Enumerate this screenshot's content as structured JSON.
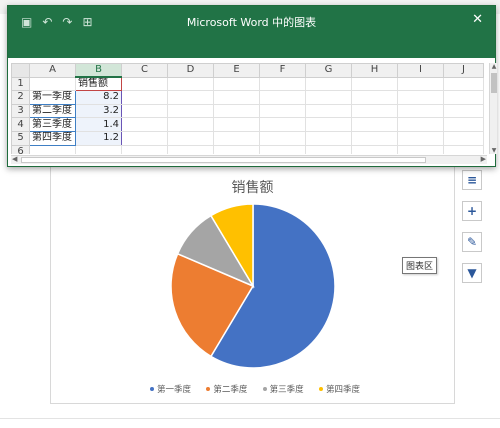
{
  "excel": {
    "title": "Microsoft Word 中的图表",
    "close": "✕",
    "qat": {
      "save": "▣",
      "undo": "↶",
      "redo": "↷",
      "table": "⊞"
    },
    "columns": [
      "A",
      "B",
      "C",
      "D",
      "E",
      "F",
      "G",
      "H",
      "I",
      "J"
    ],
    "rows": [
      {
        "n": "1",
        "a": "",
        "b": "销售额"
      },
      {
        "n": "2",
        "a": "第一季度",
        "b": "8.2"
      },
      {
        "n": "3",
        "a": "第二季度",
        "b": "3.2"
      },
      {
        "n": "4",
        "a": "第三季度",
        "b": "1.4"
      },
      {
        "n": "5",
        "a": "第四季度",
        "b": "1.2"
      },
      {
        "n": "6",
        "a": "",
        "b": ""
      }
    ]
  },
  "side_tools": {
    "layout": "≡",
    "add": "+",
    "style": "✎",
    "filter": "▼"
  },
  "tooltip": "图表区",
  "chart_data": {
    "type": "pie",
    "title": "销售额",
    "categories": [
      "第一季度",
      "第二季度",
      "第三季度",
      "第四季度"
    ],
    "values": [
      8.2,
      3.2,
      1.4,
      1.2
    ],
    "colors": [
      "#4472c4",
      "#ed7d31",
      "#a5a5a5",
      "#ffc000"
    ],
    "legend_position": "bottom"
  }
}
